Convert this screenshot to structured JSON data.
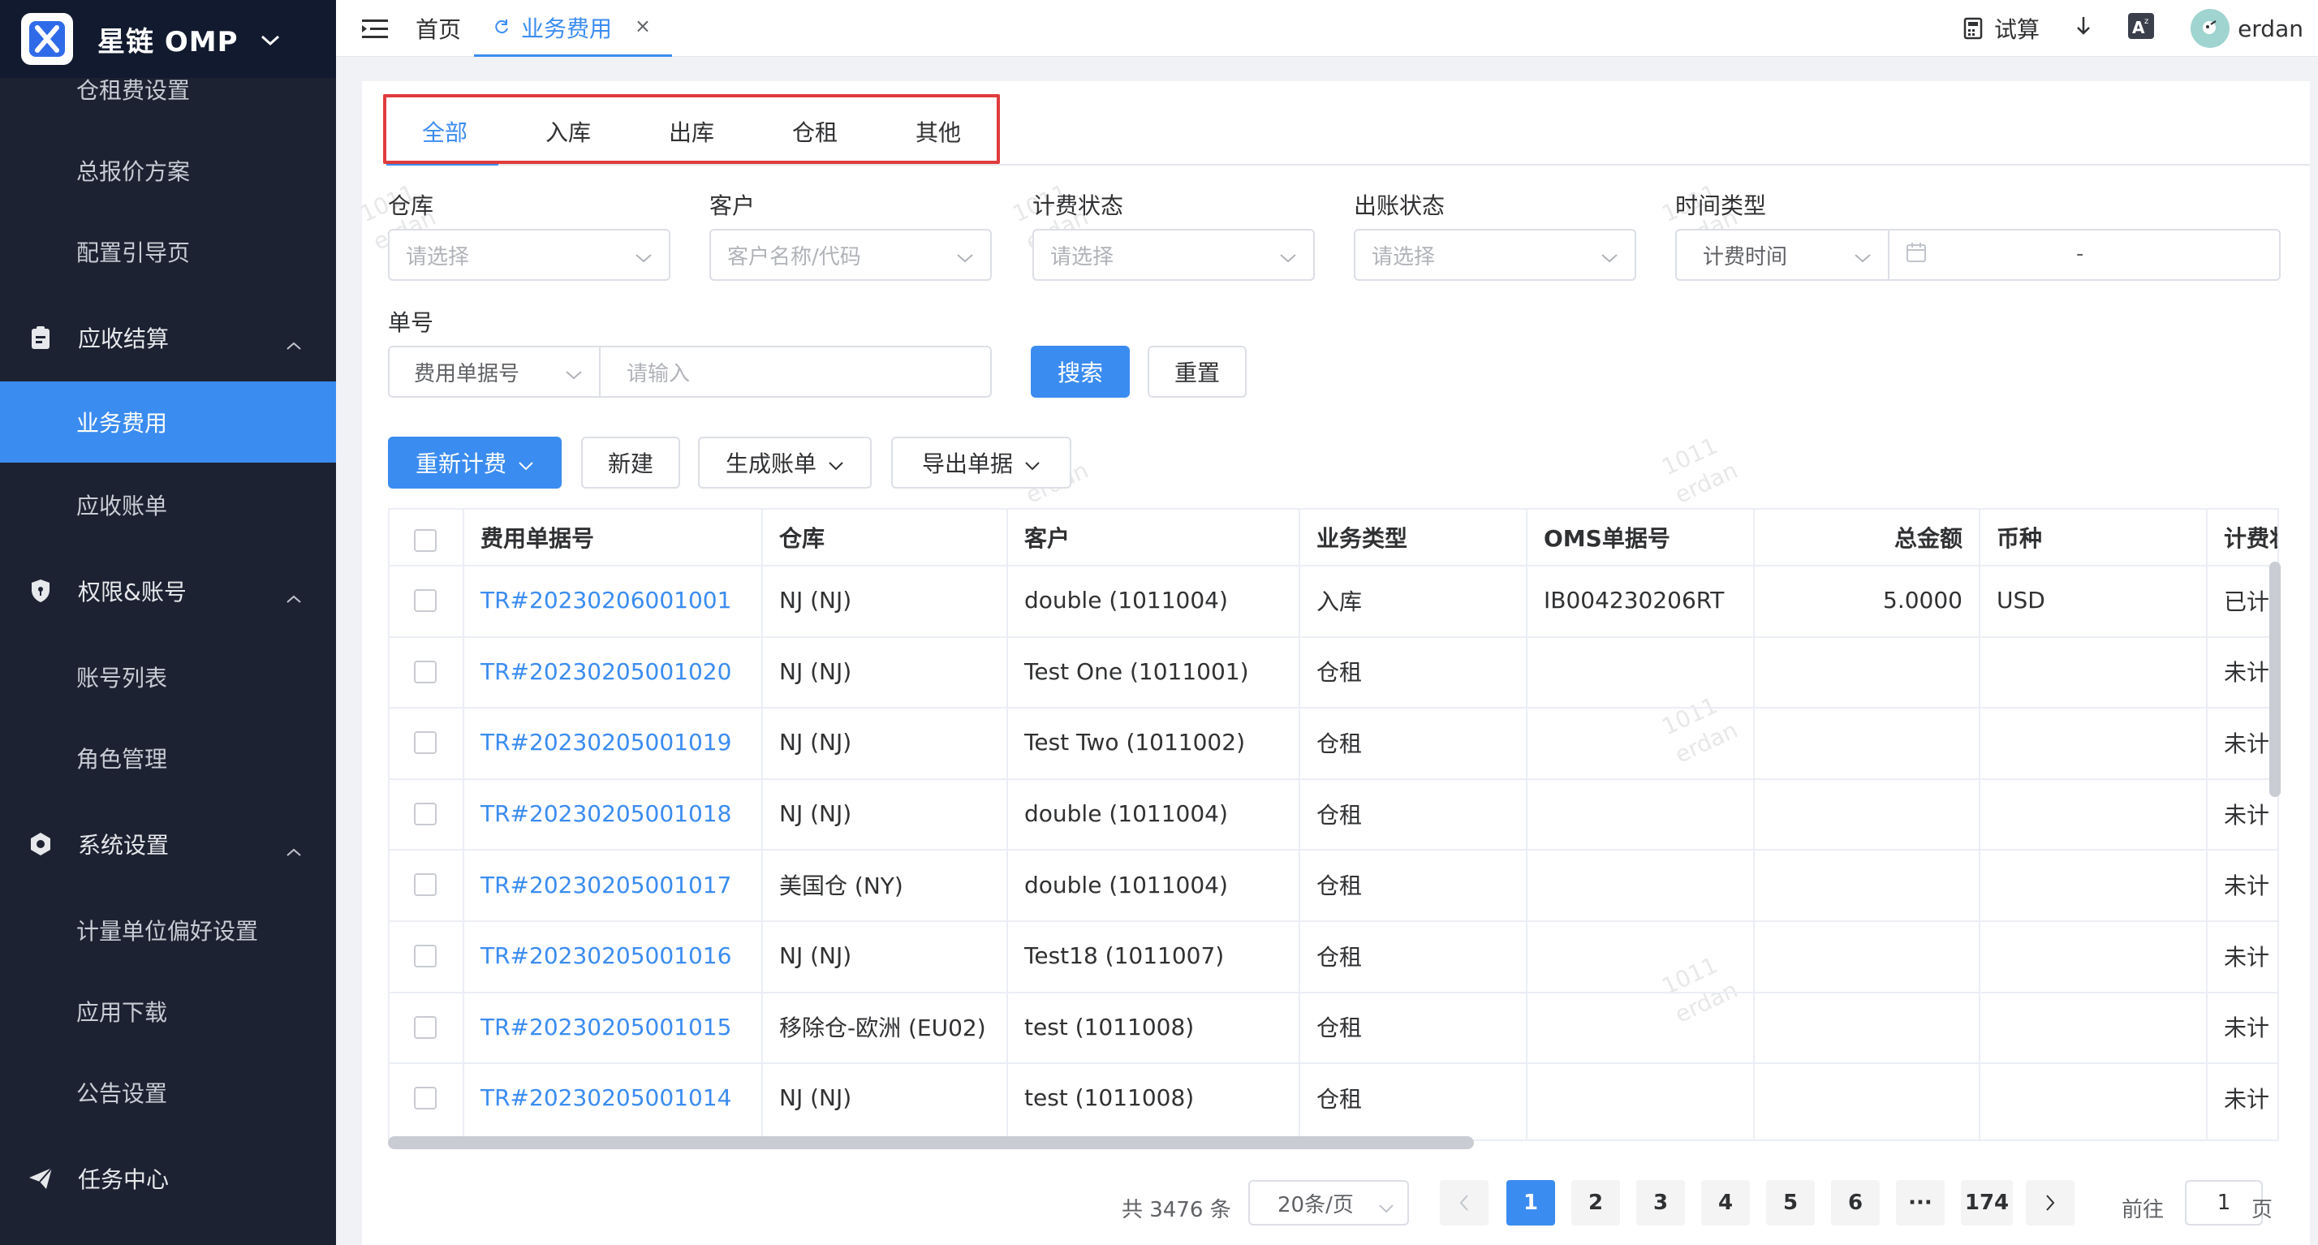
{
  "app": {
    "brand": "星链 OMP"
  },
  "sidebar": {
    "items": [
      {
        "label": "仓租费设置"
      },
      {
        "label": "总报价方案"
      },
      {
        "label": "配置引导页"
      },
      {
        "label": "应收结算"
      },
      {
        "label": "业务费用"
      },
      {
        "label": "应收账单"
      },
      {
        "label": "权限&账号"
      },
      {
        "label": "账号列表"
      },
      {
        "label": "角色管理"
      },
      {
        "label": "系统设置"
      },
      {
        "label": "计量单位偏好设置"
      },
      {
        "label": "应用下载"
      },
      {
        "label": "公告设置"
      },
      {
        "label": "任务中心"
      }
    ]
  },
  "topbar": {
    "home_tab": "首页",
    "active_tab": "业务费用",
    "trial_calc": "试算",
    "user": "erdan"
  },
  "type_tabs": [
    "全部",
    "入库",
    "出库",
    "仓租",
    "其他"
  ],
  "filters": {
    "warehouse": {
      "label": "仓库",
      "placeholder": "请选择"
    },
    "customer": {
      "label": "客户",
      "placeholder": "客户名称/代码"
    },
    "billing_status": {
      "label": "计费状态",
      "placeholder": "请选择"
    },
    "bill_status": {
      "label": "出账状态",
      "placeholder": "请选择"
    },
    "time_type": {
      "label": "时间类型",
      "value": "计费时间",
      "range_sep": "-"
    },
    "order_no": {
      "label": "单号",
      "type": "费用单据号",
      "placeholder": "请输入"
    }
  },
  "buttons": {
    "search": "搜索",
    "reset": "重置",
    "recalc": "重新计费",
    "new": "新建",
    "gen_bill": "生成账单",
    "export": "导出单据"
  },
  "table": {
    "headers": [
      "费用单据号",
      "仓库",
      "客户",
      "业务类型",
      "OMS单据号",
      "总金额",
      "币种",
      "计费状"
    ],
    "rows": [
      [
        "TR#20230206001001",
        "NJ (NJ)",
        "double (1011004)",
        "入库",
        "IB004230206RT",
        "5.0000",
        "USD",
        "已计"
      ],
      [
        "TR#20230205001020",
        "NJ (NJ)",
        "Test One (1011001)",
        "仓租",
        "",
        "",
        "",
        "未计"
      ],
      [
        "TR#20230205001019",
        "NJ (NJ)",
        "Test Two (1011002)",
        "仓租",
        "",
        "",
        "",
        "未计"
      ],
      [
        "TR#20230205001018",
        "NJ (NJ)",
        "double (1011004)",
        "仓租",
        "",
        "",
        "",
        "未计"
      ],
      [
        "TR#20230205001017",
        "美国仓 (NY)",
        "double (1011004)",
        "仓租",
        "",
        "",
        "",
        "未计"
      ],
      [
        "TR#20230205001016",
        "NJ (NJ)",
        "Test18 (1011007)",
        "仓租",
        "",
        "",
        "",
        "未计"
      ],
      [
        "TR#20230205001015",
        "移除仓-欧洲 (EU02)",
        "test (1011008)",
        "仓租",
        "",
        "",
        "",
        "未计"
      ],
      [
        "TR#20230205001014",
        "NJ (NJ)",
        "test (1011008)",
        "仓租",
        "",
        "",
        "",
        "未计"
      ]
    ]
  },
  "pagination": {
    "total": "共 3476 条",
    "page_size": "20条/页",
    "pages": [
      "1",
      "2",
      "3",
      "4",
      "5",
      "6",
      "···",
      "174"
    ],
    "goto_label": "前往",
    "goto_value": "1",
    "page_suffix": "页"
  },
  "watermark": {
    "line1": "1011",
    "line2": "erdan"
  },
  "colors": {
    "primary": "#3b8cf0",
    "sidebar_bg": "#1d2232",
    "highlight_box": "#e03c3c"
  }
}
